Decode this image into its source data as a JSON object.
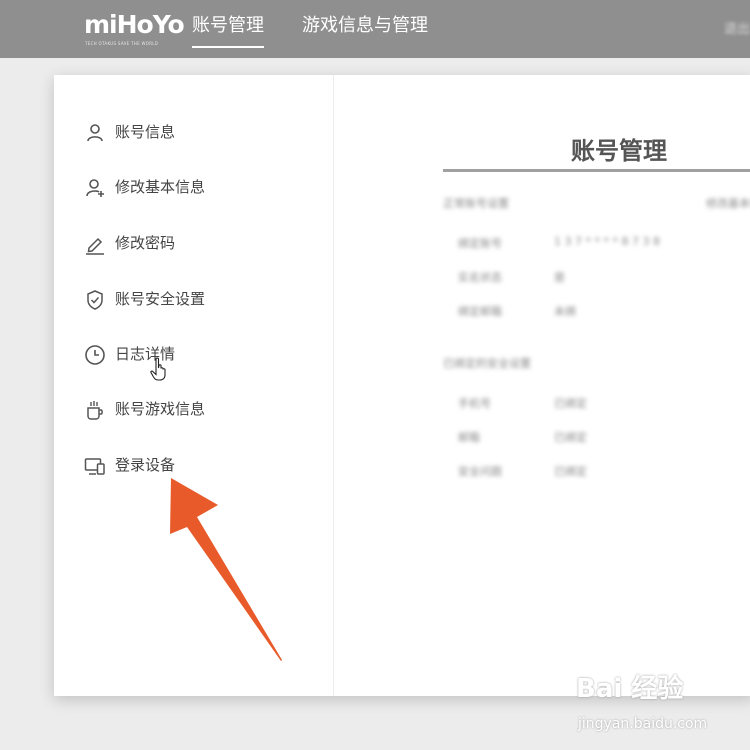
{
  "topbar": {
    "logo_text": "miHoYo",
    "logo_tagline": "TECH OTAKUS SAVE THE WORLD",
    "tabs": [
      {
        "label": "账号管理",
        "active": true
      },
      {
        "label": "游戏信息与管理",
        "active": false
      }
    ],
    "corner_text": "退出"
  },
  "sidebar": {
    "items": [
      {
        "label": "账号信息",
        "icon": "user-icon"
      },
      {
        "label": "修改基本信息",
        "icon": "user-add-icon"
      },
      {
        "label": "修改密码",
        "icon": "pencil-icon"
      },
      {
        "label": "账号安全设置",
        "icon": "shield-check-icon"
      },
      {
        "label": "日志详情",
        "icon": "clock-icon"
      },
      {
        "label": "账号游戏信息",
        "icon": "cup-icon"
      },
      {
        "label": "登录设备",
        "icon": "devices-icon"
      }
    ]
  },
  "content": {
    "title": "账号管理",
    "section1": {
      "header": "正常账号设置",
      "header_right": "修改基本信息",
      "rows": [
        {
          "label": "绑定账号",
          "value": "1 3 7 * * * * 8 7 3 8"
        },
        {
          "label": "实名状态",
          "value": "是"
        },
        {
          "label": "绑定邮箱",
          "value": "未绑"
        }
      ]
    },
    "section2": {
      "header": "已绑定的安全设置",
      "rows": [
        {
          "label": "手机号",
          "value": "已绑定"
        },
        {
          "label": "邮箱",
          "value": "已绑定"
        },
        {
          "label": "安全问题",
          "value": "已绑定"
        }
      ]
    }
  },
  "watermark": {
    "brand": "Bai 经验",
    "url": "jingyan.baidu.com"
  },
  "colors": {
    "topbar": "#8f8f8f",
    "arrow": "#e85a2a",
    "background": "#ececec"
  }
}
